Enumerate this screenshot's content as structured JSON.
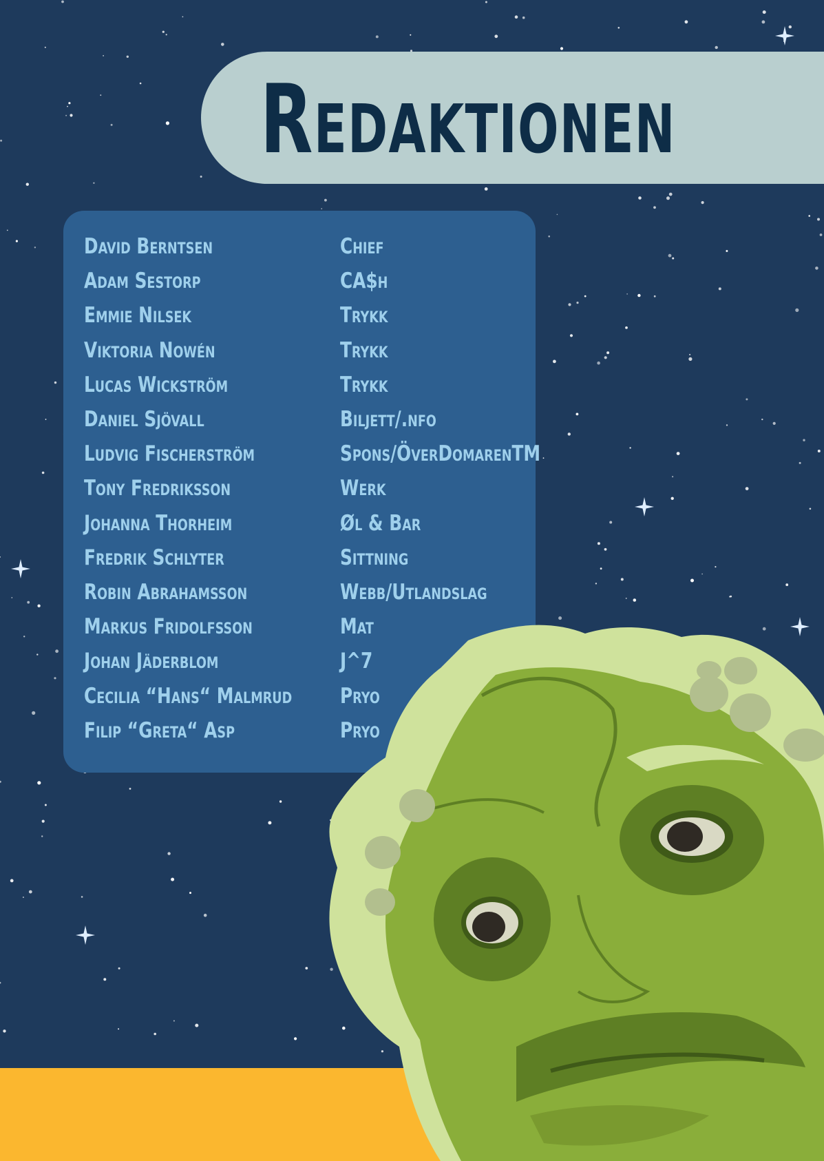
{
  "title": "Redaktionen",
  "members": [
    {
      "name": "David Berntsen",
      "role": "Chief"
    },
    {
      "name": "Adam Sestorp",
      "role": "CA$h"
    },
    {
      "name": "Emmie Nilsek",
      "role": "Trykk"
    },
    {
      "name": "Viktoria Nowén",
      "role": "Trykk"
    },
    {
      "name": "Lucas Wickström",
      "role": "Trykk"
    },
    {
      "name": "Daniel Sjövall",
      "role": "Biljett/.nfo"
    },
    {
      "name": "Ludvig Fischerström",
      "role": "Spons/ÖverDomarenTM"
    },
    {
      "name": "Tony Fredriksson",
      "role": "Werk"
    },
    {
      "name": "Johanna Thorheim",
      "role": "Øl & Bar"
    },
    {
      "name": "Fredrik Schlyter",
      "role": "Sittning"
    },
    {
      "name": "Robin Abrahamsson",
      "role": "Webb/Utlandslag"
    },
    {
      "name": "Markus Fridolfsson",
      "role": "Mat"
    },
    {
      "name": "Johan Jäderblom",
      "role": "J^7"
    },
    {
      "name": "Cecilia “Hans“ Malmrud",
      "role": "Pryo"
    },
    {
      "name": "Filip “Greta“ Asp",
      "role": "Pryo"
    }
  ],
  "colors": {
    "space": "#1e3a5c",
    "title_bar": "#b9cfcf",
    "title_text": "#0e2d47",
    "roster_panel": "#2d5f90",
    "roster_text": "#9fd0ec",
    "ground": "#fbb72f",
    "creature_light": "#cfe29c",
    "creature_mid": "#8aae3a",
    "creature_dark": "#5e7f24"
  }
}
